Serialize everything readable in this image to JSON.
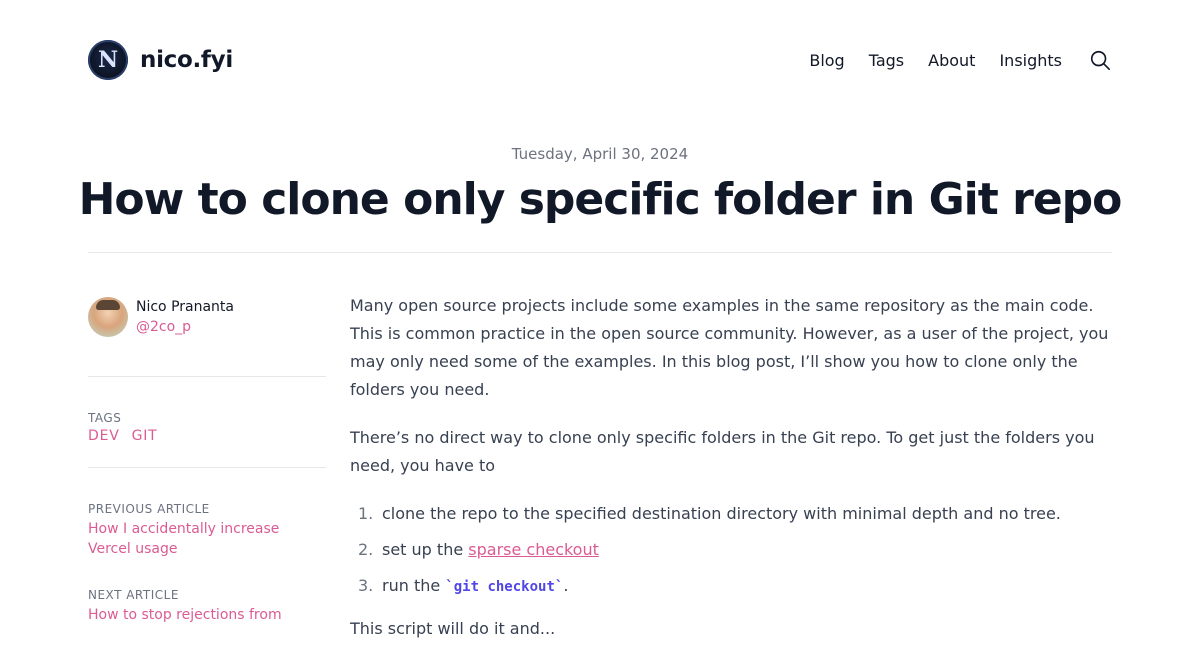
{
  "site": {
    "logo_letter": "N",
    "name": "nico.fyi"
  },
  "nav": {
    "items": [
      "Blog",
      "Tags",
      "About",
      "Insights"
    ]
  },
  "post": {
    "date": "Tuesday, April 30, 2024",
    "title": "How to clone only specific folder in Git repo"
  },
  "author": {
    "name": "Nico Prananta",
    "handle": "@2co_p"
  },
  "sidebar": {
    "tags_label": "TAGS",
    "tags": [
      "DEV",
      "GIT"
    ],
    "previous_label": "PREVIOUS ARTICLE",
    "previous_title": "How I accidentally increase Vercel usage",
    "next_label": "NEXT ARTICLE",
    "next_title": "How to stop rejections from"
  },
  "content": {
    "p1": "Many open source projects include some examples in the same repository as the main code. This is common practice in the open source community. However, as a user of the project, you may only need some of the examples. In this blog post, I’ll show you how to clone only the folders you need.",
    "p2": "There’s no direct way to clone only specific folders in the Git repo. To get just the folders you need, you have to",
    "steps": [
      {
        "num": "1.",
        "text": "clone the repo to the specified destination directory with minimal depth and no tree."
      },
      {
        "num": "2.",
        "prefix": "set up the ",
        "link": "sparse checkout"
      },
      {
        "num": "3.",
        "prefix": "run the ",
        "code": "`git checkout`",
        "suffix": "."
      }
    ],
    "p3": "This script will do it and..."
  },
  "colors": {
    "accent": "#db5b93",
    "code": "#4f46e5",
    "text": "#374151",
    "heading": "#111827",
    "muted": "#6b7280"
  },
  "icons": {
    "search": "search-icon"
  }
}
